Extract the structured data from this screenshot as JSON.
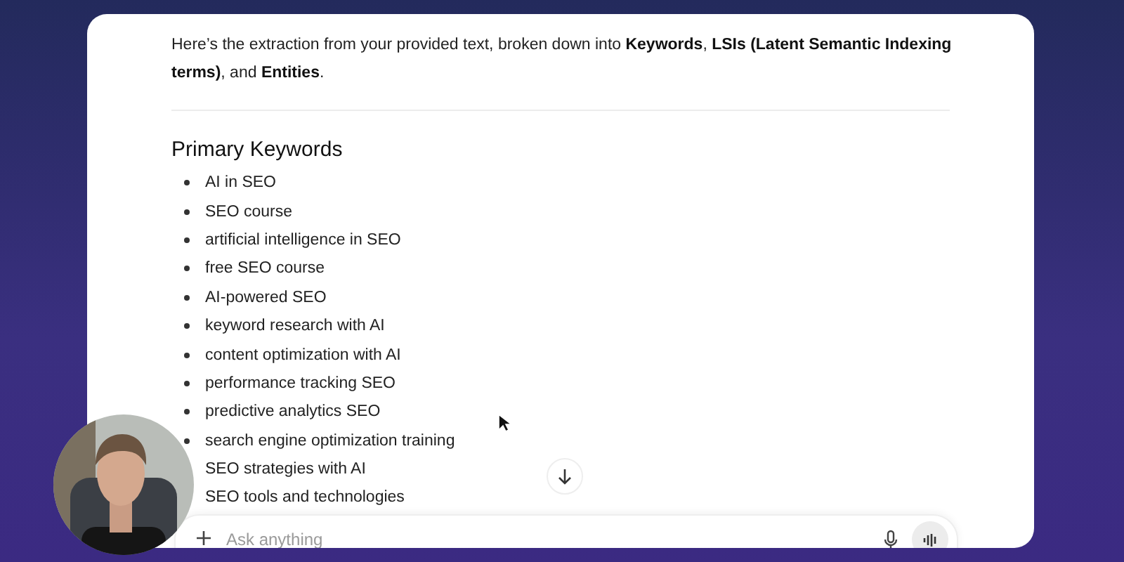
{
  "message": {
    "intro": "Here’s the extraction from your provided text, broken down into **Keywords**, **LSIs (Latent Semantic Indexing terms)**, and **Entities**.",
    "heading": "Primary Keywords",
    "keywords": [
      "AI in SEO",
      "SEO course",
      "artificial intelligence in SEO",
      "free SEO course",
      "AI-powered SEO",
      "keyword research with AI",
      "content optimization with AI",
      "performance tracking SEO",
      "predictive analytics SEO",
      "search engine optimization training",
      "SEO strategies with AI",
      "SEO tools and technologies"
    ]
  },
  "composer": {
    "placeholder": "Ask anything"
  }
}
